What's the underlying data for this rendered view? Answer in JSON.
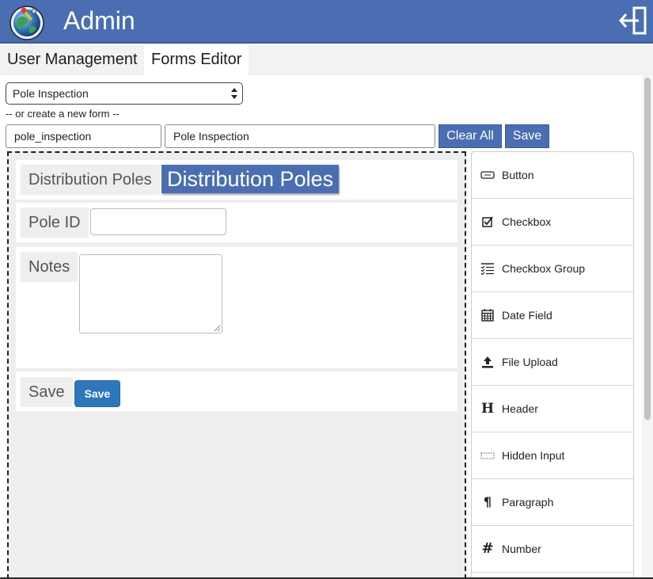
{
  "app": {
    "title": "Admin",
    "colors": {
      "header": "#4a6eb1",
      "button": "#4a6eb1",
      "save_form_button": "#2e77bb"
    }
  },
  "tabs": [
    {
      "label": "User Management",
      "active": false
    },
    {
      "label": "Forms Editor",
      "active": true
    }
  ],
  "editor": {
    "selected_form": "Pole Inspection",
    "create_label": "-- or create a new form --",
    "form_id_value": "pole_inspection",
    "form_name_value": "Pole Inspection",
    "clear_all_label": "Clear All",
    "save_label": "Save"
  },
  "canvas": {
    "header_field": {
      "label": "Distribution Poles",
      "value": "Distribution Poles"
    },
    "pole_id_field": {
      "label": "Pole ID",
      "value": ""
    },
    "notes_field": {
      "label": "Notes",
      "value": ""
    },
    "save_field": {
      "label": "Save",
      "button_label": "Save"
    }
  },
  "palette": {
    "items": [
      {
        "label": "Button",
        "icon": "button-icon"
      },
      {
        "label": "Checkbox",
        "icon": "checkbox-icon"
      },
      {
        "label": "Checkbox Group",
        "icon": "checkbox-group-icon"
      },
      {
        "label": "Date Field",
        "icon": "calendar-icon"
      },
      {
        "label": "File Upload",
        "icon": "upload-icon"
      },
      {
        "label": "Header",
        "icon": "header-icon",
        "glyph": "H"
      },
      {
        "label": "Hidden Input",
        "icon": "hidden-input-icon"
      },
      {
        "label": "Paragraph",
        "icon": "pilcrow-icon",
        "glyph": "¶"
      },
      {
        "label": "Number",
        "icon": "hash-icon",
        "glyph": "#"
      }
    ]
  }
}
